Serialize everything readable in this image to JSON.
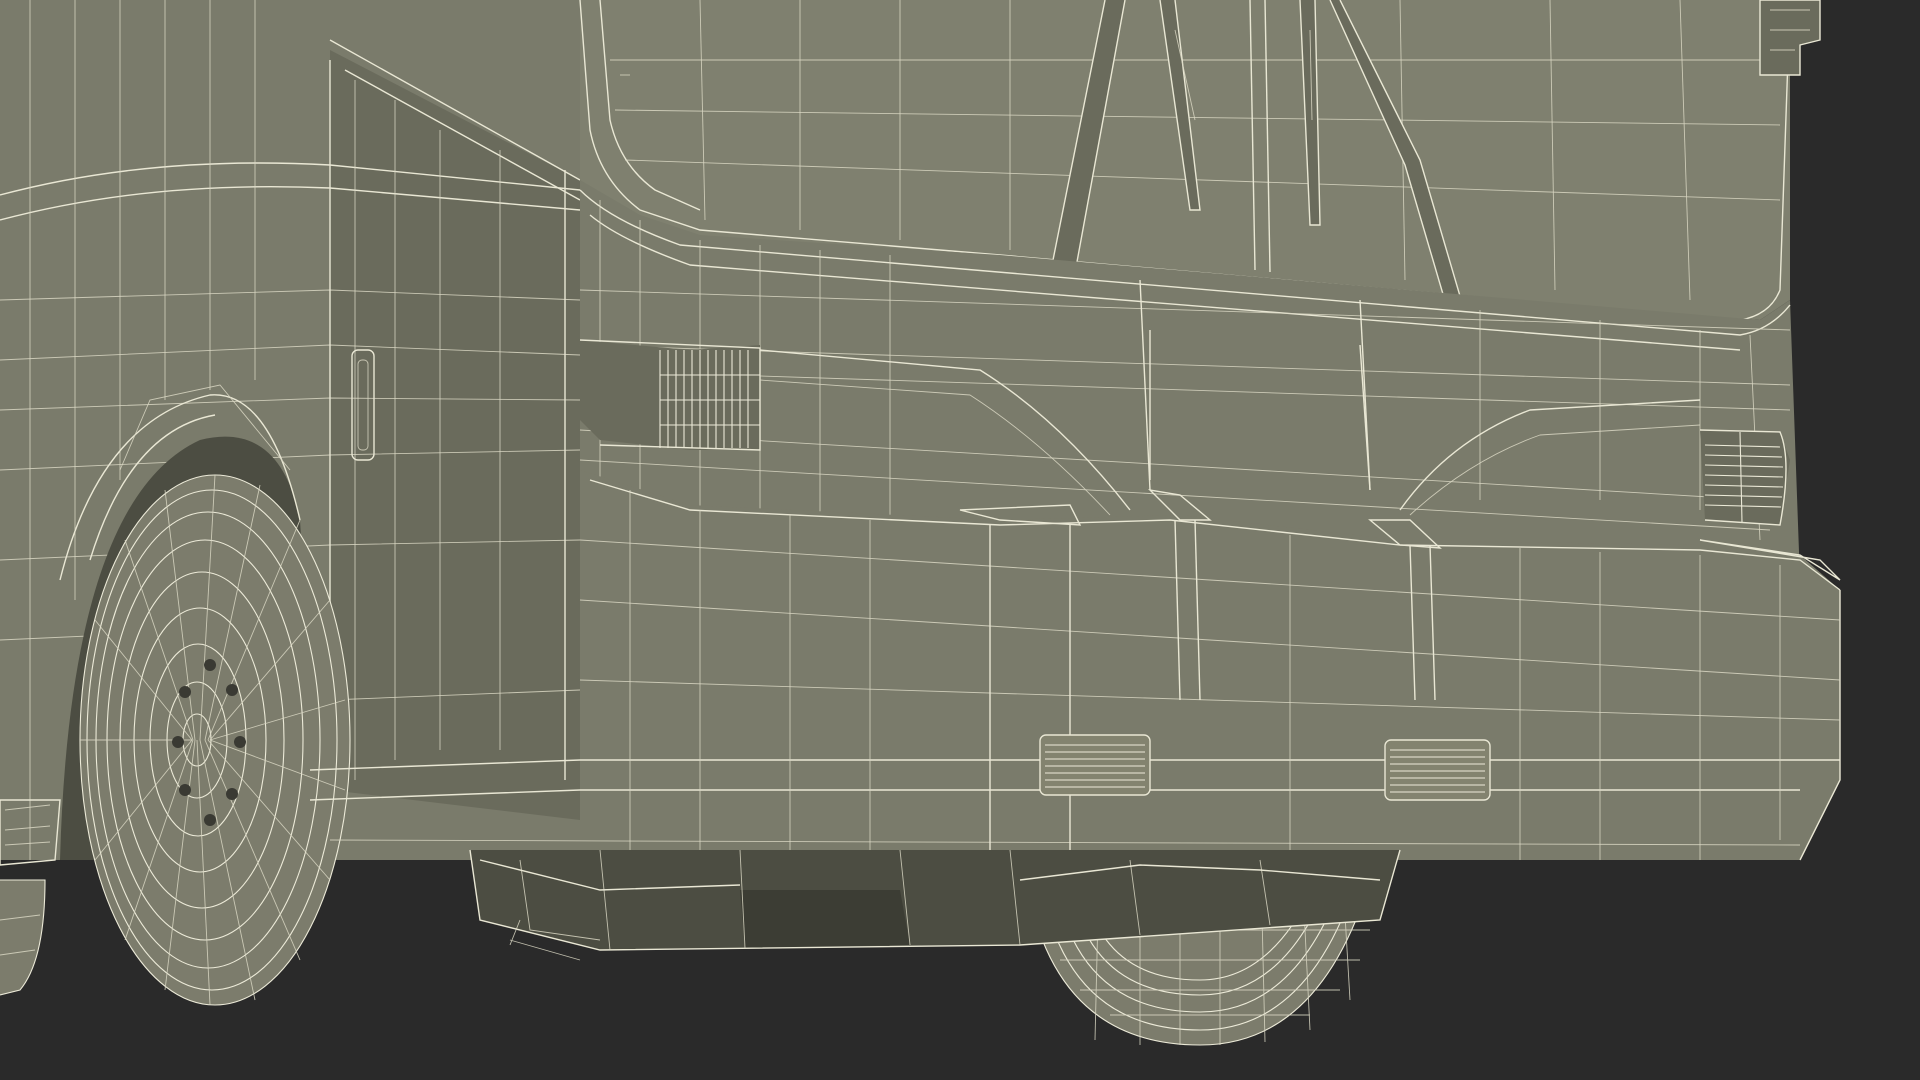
{
  "scene": {
    "subject": "bus-front-wireframe",
    "background_color": "#2a2a2a",
    "body_color": "#7a7b6b",
    "wire_color": "#e9e7d4"
  }
}
